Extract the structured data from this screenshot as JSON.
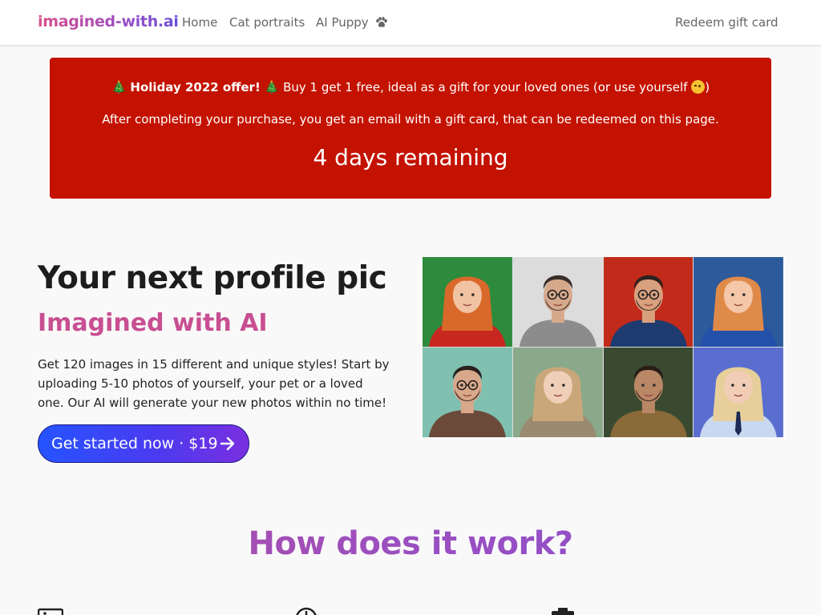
{
  "navbar": {
    "brand": "imagined-with.ai",
    "links": {
      "home": "Home",
      "cat_portraits": "Cat portraits",
      "ai_puppy": "AI Puppy",
      "redeem": "Redeem gift card"
    }
  },
  "offer": {
    "title_bold": "Holiday 2022 offer!",
    "title_rest": "Buy 1 get 1 free, ideal as a gift for your loved ones (or use yourself",
    "title_close": ")",
    "description": "After completing your purchase, you get an email with a gift card, that can be redeemed on this page.",
    "remaining": "4 days remaining",
    "background_color": "#c41200"
  },
  "hero": {
    "title": "Your next profile pic",
    "subtitle": "Imagined with AI",
    "description": "Get 120 images in 15 different and unique styles! Start by uploading 5-10 photos of yourself, your pet or a loved one. Our AI will generate your new photos within no time!",
    "cta_label": "Get started now · $19"
  },
  "gallery": {
    "portraits": [
      {
        "subject": "woman-christmas-sweater",
        "bg": "#2e8a3c",
        "hair": "#d9692a",
        "shirt": "#c8271f",
        "skin": "#f2c3a3"
      },
      {
        "subject": "man-glasses-sketch",
        "bg": "#dcdcdc",
        "hair": "#3a2f2a",
        "shirt": "#8c8c8c",
        "skin": "#d7a98c"
      },
      {
        "subject": "man-glasses-red",
        "bg": "#c22a1a",
        "hair": "#2b2220",
        "shirt": "#1d3b6e",
        "skin": "#d9a07e"
      },
      {
        "subject": "woman-blue-blazer",
        "bg": "#2d5a9a",
        "hair": "#e08a4a",
        "shirt": "#2350a8",
        "skin": "#f3c7a8"
      },
      {
        "subject": "man-christmas-sweater",
        "bg": "#7fc0b0",
        "hair": "#2a1f1c",
        "shirt": "#6b4a3a",
        "skin": "#d9a88a"
      },
      {
        "subject": "woman-elf",
        "bg": "#8aa88a",
        "hair": "#c9a77a",
        "shirt": "#9a8a70",
        "skin": "#efcfb8"
      },
      {
        "subject": "man-armor",
        "bg": "#3a4a30",
        "hair": "#2a1d15",
        "shirt": "#8a6a38",
        "skin": "#b98766"
      },
      {
        "subject": "woman-blonde-tie",
        "bg": "#5a6ed0",
        "hair": "#e6cf9a",
        "shirt": "#c8d8f0",
        "skin": "#f1cdb6"
      }
    ]
  },
  "how": {
    "title": "How does it work?"
  },
  "colors": {
    "accent_pink": "#c84f92",
    "accent_purple": "#9a4fc0",
    "cta_start": "#2554ff",
    "cta_end": "#7a2fe0"
  }
}
